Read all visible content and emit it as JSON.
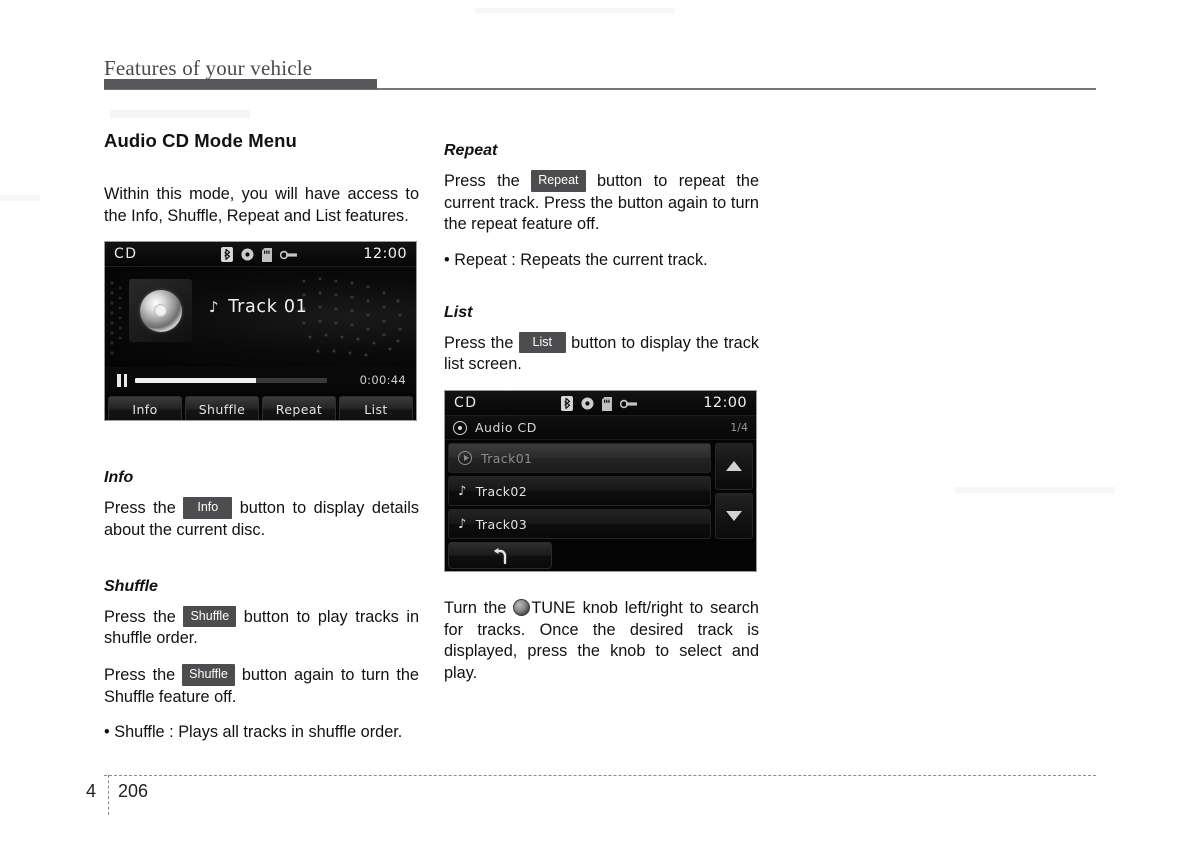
{
  "header": {
    "title": "Features of your vehicle"
  },
  "footer": {
    "chapter": "4",
    "page": "206"
  },
  "left_column": {
    "section_title": "Audio CD Mode Menu",
    "intro": "Within this mode, you will have access to the Info, Shuffle, Repeat and List features.",
    "info": {
      "heading": "Info",
      "text_before": "Press the",
      "key": "Info",
      "text_after": "button to display details about the current disc."
    },
    "shuffle": {
      "heading": "Shuffle",
      "p1_before": "Press the",
      "p1_key": "Shuffle",
      "p1_after": "button to play tracks in shuffle order.",
      "p2_before": "Press the",
      "p2_key": "Shuffle",
      "p2_after": "button again to turn the Shuffle feature off.",
      "bullet": "• Shuffle : Plays all tracks in shuffle order."
    }
  },
  "right_column": {
    "repeat": {
      "heading": "Repeat",
      "text_before": "Press the",
      "key": "Repeat",
      "text_after": "button to repeat the current track. Press the button again to turn the repeat feature off.",
      "bullet": "• Repeat : Repeats the current track."
    },
    "list": {
      "heading": "List",
      "text_before": "Press the",
      "key": "List",
      "text_after": "button to display the track list screen."
    },
    "tune_note": {
      "text_before": "Turn the",
      "knob_icon": "tune-knob-icon",
      "text_after": "TUNE knob left/right to search for tracks. Once the desired track is displayed, press the knob to select and play."
    }
  },
  "now_playing_screen": {
    "statusbar": {
      "source": "CD",
      "clock": "12:00",
      "icons": [
        "bluetooth-icon",
        "disc-icon",
        "sd-card-icon",
        "usb-icon"
      ]
    },
    "album_art": "cd-disc-icon",
    "track_note_icon": "music-note-icon",
    "track_title": "Track 01",
    "transport_icon": "pause-icon",
    "progress_percent": 63,
    "elapsed_time": "0:00:44",
    "soft_keys": [
      "Info",
      "Shuffle",
      "Repeat",
      "List"
    ]
  },
  "track_list_screen": {
    "statusbar": {
      "source": "CD",
      "clock": "12:00",
      "icons": [
        "bluetooth-icon",
        "disc-icon",
        "sd-card-icon",
        "usb-icon"
      ]
    },
    "list_header": {
      "icon": "cd-disc-icon",
      "label": "Audio CD",
      "page_indicator": "1/4"
    },
    "tracks": [
      {
        "label": "Track01",
        "icon": "play-icon",
        "current": true
      },
      {
        "label": "Track02",
        "icon": "music-note-icon",
        "current": false
      },
      {
        "label": "Track03",
        "icon": "music-note-icon",
        "current": false
      }
    ],
    "scroll_up_icon": "triangle-up-icon",
    "scroll_down_icon": "triangle-down-icon",
    "back_icon": "back-arrow-icon"
  },
  "colors": {
    "rule": "#58585a",
    "key_badge": "#4d4d4f",
    "lcd_background": "#050505",
    "text": "#111111"
  }
}
